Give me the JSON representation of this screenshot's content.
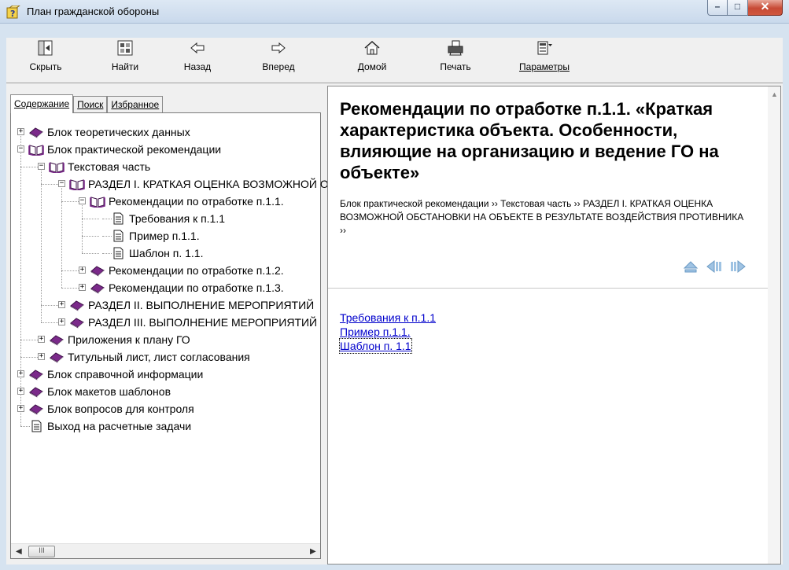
{
  "window": {
    "title": "План гражданской обороны",
    "controls": {
      "minimize": "–",
      "maximize": "□",
      "close": "✕"
    }
  },
  "toolbar": {
    "buttons": [
      {
        "label": "Скрыть",
        "icon": "hide-panel-icon"
      },
      {
        "label": "Найти",
        "icon": "find-icon"
      },
      {
        "label": "Назад",
        "icon": "back-arrow-icon"
      },
      {
        "label": "Вперед",
        "icon": "forward-arrow-icon"
      },
      {
        "label": "Домой",
        "icon": "home-icon"
      },
      {
        "label": "Печать",
        "icon": "print-icon"
      },
      {
        "label": "Параметры",
        "icon": "options-icon"
      }
    ]
  },
  "tabs": {
    "contents": "Содержание",
    "search": "Поиск",
    "favorites": "Избранное"
  },
  "tree": [
    {
      "label": "Блок теоретических данных",
      "icon": "closed-book-icon",
      "expander": "+"
    },
    {
      "label": "Блок практической рекомендации",
      "icon": "open-book-icon",
      "expander": "−"
    },
    {
      "label": "Текстовая часть",
      "icon": "open-book-icon",
      "expander": "−"
    },
    {
      "label": "РАЗДЕЛ I. КРАТКАЯ ОЦЕНКА ВОЗМОЖНОЙ ОБСТАНОВКИ",
      "icon": "open-book-icon",
      "expander": "−"
    },
    {
      "label": "Рекомендации по отработке п.1.1.",
      "icon": "open-book-icon",
      "expander": "−"
    },
    {
      "label": "Требования к п.1.1",
      "icon": "page-icon",
      "expander": ""
    },
    {
      "label": "Пример п.1.1.",
      "icon": "page-icon",
      "expander": ""
    },
    {
      "label": "Шаблон п. 1.1.",
      "icon": "page-icon",
      "expander": ""
    },
    {
      "label": "Рекомендации по отработке п.1.2.",
      "icon": "closed-book-icon",
      "expander": "+"
    },
    {
      "label": "Рекомендации по отработке п.1.3.",
      "icon": "closed-book-icon",
      "expander": "+"
    },
    {
      "label": "РАЗДЕЛ II. ВЫПОЛНЕНИЕ МЕРОПРИЯТИЙ",
      "icon": "closed-book-icon",
      "expander": "+"
    },
    {
      "label": "РАЗДЕЛ III. ВЫПОЛНЕНИЕ МЕРОПРИЯТИЙ",
      "icon": "closed-book-icon",
      "expander": "+"
    },
    {
      "label": "Приложения к плану ГО",
      "icon": "closed-book-icon",
      "expander": "+"
    },
    {
      "label": "Титульный лист, лист согласования",
      "icon": "closed-book-icon",
      "expander": "+"
    },
    {
      "label": "Блок справочной информации",
      "icon": "closed-book-icon",
      "expander": "+"
    },
    {
      "label": "Блок макетов шаблонов",
      "icon": "closed-book-icon",
      "expander": "+"
    },
    {
      "label": "Блок вопросов для контроля",
      "icon": "closed-book-icon",
      "expander": "+"
    },
    {
      "label": "Выход на расчетные задачи",
      "icon": "page-icon",
      "expander": ""
    }
  ],
  "hscroll": {
    "thumb": "III"
  },
  "content": {
    "title": "Рекомендации по отработке п.1.1. «Краткая характеристика объекта. Особенности, влияющие на организацию и ведение ГО на объекте»",
    "breadcrumb": "Блок практической рекомендации ›› Текстовая часть ›› РАЗДЕЛ I. КРАТКАЯ ОЦЕНКА ВОЗМОЖНОЙ ОБСТАНОВКИ НА ОБЪЕКТЕ В РЕЗУЛЬТАТЕ ВОЗДЕЙСТВИЯ ПРОТИВНИКА ››",
    "links": [
      "Требования к п.1.1",
      "Пример п.1.1.",
      "Шаблон п. 1.1"
    ]
  },
  "colors": {
    "book_closed": "#7b2a8a",
    "book_open": "#7b2a8a",
    "link": "#0000cc",
    "nav_arrows": "#9fc3e3"
  }
}
